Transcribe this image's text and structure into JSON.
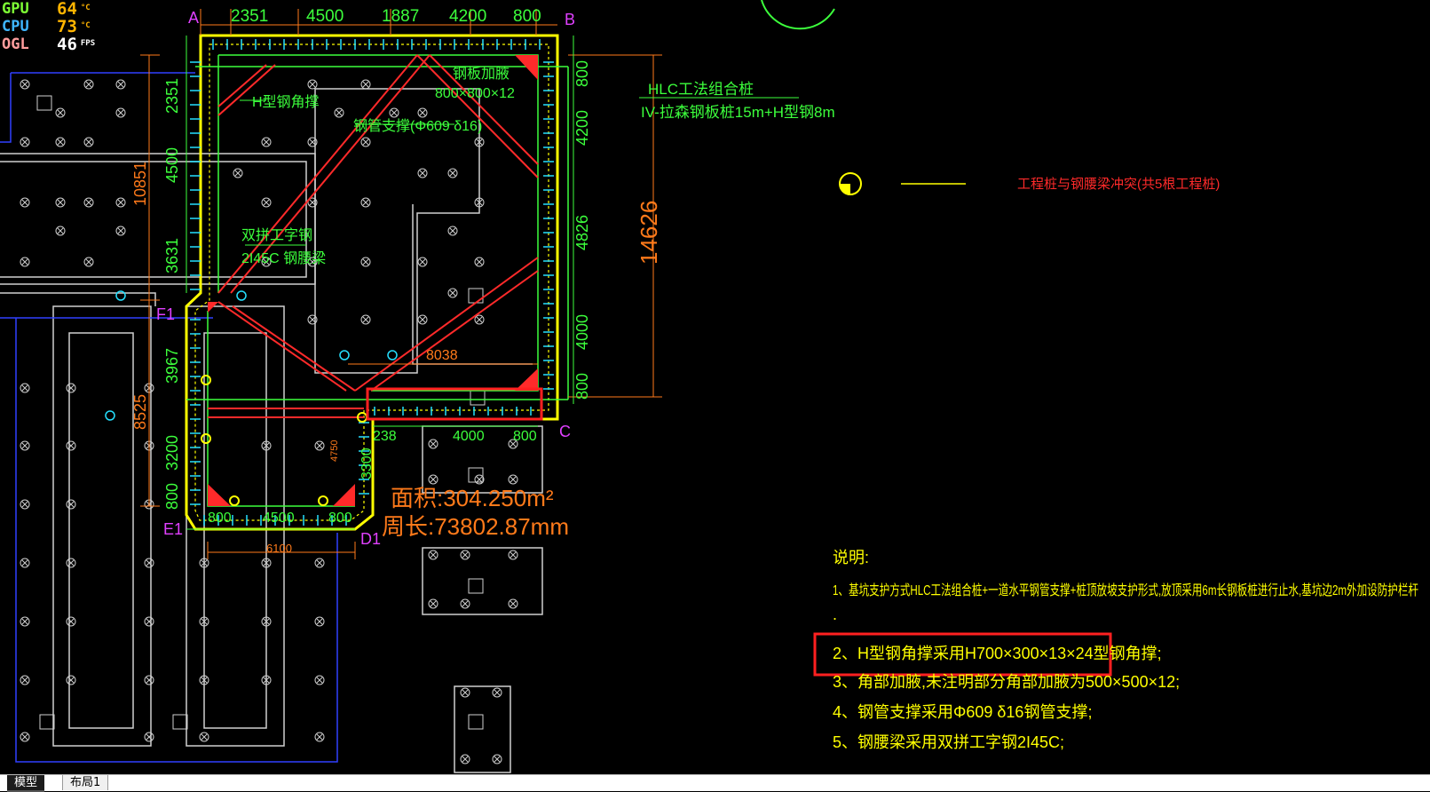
{
  "hud": {
    "rows": [
      {
        "label": "GPU",
        "value": "64",
        "unit": "°C",
        "label_color": "#7dff35",
        "value_color": "#ffb400"
      },
      {
        "label": "CPU",
        "value": "73",
        "unit": "°C",
        "label_color": "#3fb6ff",
        "value_color": "#ffb400"
      },
      {
        "label": "OGL",
        "value": "46",
        "unit": "FPS",
        "label_color": "#ff9e9e",
        "value_color": "#ffffff"
      }
    ]
  },
  "drawing": {
    "top_dims": [
      "2351",
      "4500",
      "1887",
      "4200",
      "800"
    ],
    "corner_a": "A",
    "corner_b": "B",
    "corner_c": "C",
    "corner_d1": "D1",
    "corner_e1": "E1",
    "corner_f1": "F1",
    "left_dims": [
      "2351",
      "4500",
      "10851",
      "3631",
      "3967",
      "8525",
      "3200",
      "800"
    ],
    "right_dims": [
      "800",
      "4200",
      "4826",
      "14626",
      "4000",
      "800"
    ],
    "inner_dims": [
      "8038",
      "238",
      "4000",
      "800",
      "6100",
      "800",
      "4500",
      "800",
      "3300",
      "4750"
    ],
    "labels": {
      "h_brace": "H型钢角撑",
      "plate_1": "钢板加腋",
      "plate_2": "800×800×12",
      "pipe_brace": "钢管支撑(Φ609 δ16)",
      "double_i_1": "双拼工字钢",
      "double_i_2": "2I45C 钢腰梁",
      "hlc_1": "HLC工法组合桩",
      "hlc_2": "IV-拉森钢板桩15m+H型钢8m",
      "area": "面积:304.250m²",
      "perimeter": "周长:73802.87mm"
    },
    "legend_text": "工程桩与钢腰梁冲突(共5根工程桩)"
  },
  "notes": {
    "title": "说明:",
    "items": [
      "1、基坑支护方式HLC工法组合桩+一道水平钢管支撑+桩顶放坡支护形式,放顶采用6m长钢板桩进行止水,基坑边2m外加设防护栏杆",
      ".",
      "2、H型钢角撑采用H700×300×13×24型钢角撑;",
      "3、角部加腋,未注明部分角部加腋为500×500×12;",
      "4、钢管支撑采用Φ609 δ16钢管支撑;",
      "5、钢腰梁采用双拼工字钢2I45C;"
    ]
  },
  "tabs": {
    "model": "模型",
    "layout1": "布局1"
  },
  "colors": {
    "background": "#000000",
    "dim_orange": "#ff7a1a",
    "green": "#3cff3c",
    "yellow": "#ffff00",
    "red": "#ff2a2a",
    "cyan": "#25e0ff",
    "white": "#cfcfcf",
    "blue": "#3040ff",
    "magenta": "#e040ff"
  }
}
